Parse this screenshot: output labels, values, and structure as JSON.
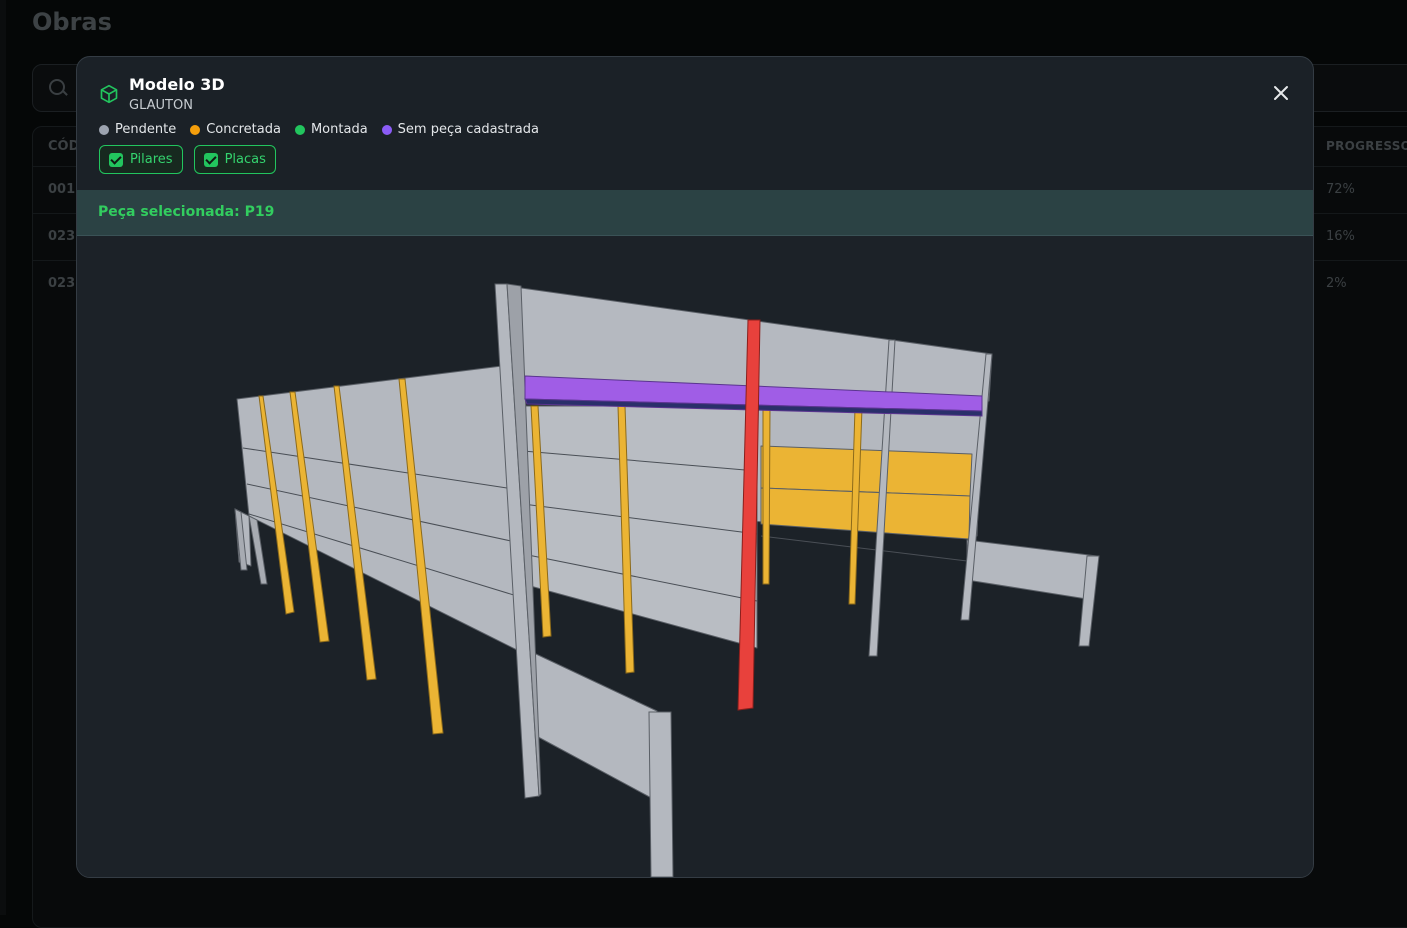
{
  "background": {
    "page_title": "Obras",
    "table": {
      "first_column_header": "CÓD",
      "last_column_header": "PROGRESSO",
      "rows": [
        {
          "code": "001",
          "progress": "72%"
        },
        {
          "code": "023",
          "progress": "16%"
        },
        {
          "code": "023",
          "progress": "2%"
        }
      ]
    }
  },
  "modal": {
    "title": "Modelo 3D",
    "subtitle": "GLAUTON",
    "close_icon": "close-icon",
    "header_icon": "cube-icon",
    "legend": [
      {
        "label": "Pendente",
        "color": "#9ca3af"
      },
      {
        "label": "Concretada",
        "color": "#f59e0b"
      },
      {
        "label": "Montada",
        "color": "#22c55e"
      },
      {
        "label": "Sem peça cadastrada",
        "color": "#8b5cf6"
      }
    ],
    "filters": [
      {
        "label": "Pilares",
        "checked": true
      },
      {
        "label": "Placas",
        "checked": true
      }
    ],
    "selected_piece": "Peça selecionada: P19"
  },
  "model_colors": {
    "pending": "#b4b8bf",
    "concreted": "#ebb434",
    "unregistered": "#a05de6",
    "selected": "#e8413c",
    "background": "#1c2228",
    "accent": "#22c55e"
  }
}
